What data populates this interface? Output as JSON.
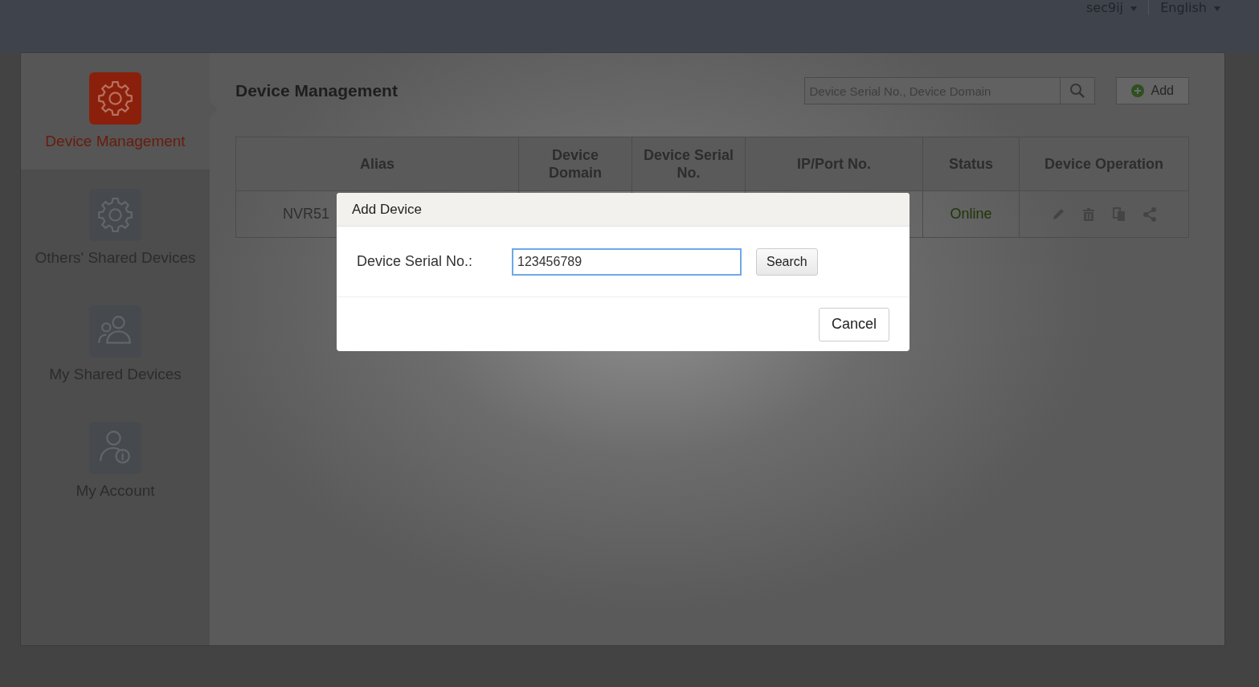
{
  "top_bar": {
    "user": "sec9ij",
    "language": "English"
  },
  "sidebar": {
    "items": [
      {
        "label": "Device Management",
        "selected": true
      },
      {
        "label": "Others' Shared Devices",
        "selected": false
      },
      {
        "label": "My Shared Devices",
        "selected": false
      },
      {
        "label": "My Account",
        "selected": false
      }
    ]
  },
  "page_title": "Device Management",
  "search": {
    "placeholder": "Device Serial No., Device Domain"
  },
  "add_button": "Add",
  "table": {
    "columns": [
      "Alias",
      "Device Domain",
      "Device Serial No.",
      "IP/Port No.",
      "Status",
      "Device Operation"
    ],
    "rows": [
      {
        "alias": "NVR51",
        "status": "Online"
      }
    ]
  },
  "dialog": {
    "title": "Add Device",
    "field_label": "Device Serial No.:",
    "field_value": "123456789",
    "search_button": "Search",
    "cancel_button": "Cancel"
  }
}
